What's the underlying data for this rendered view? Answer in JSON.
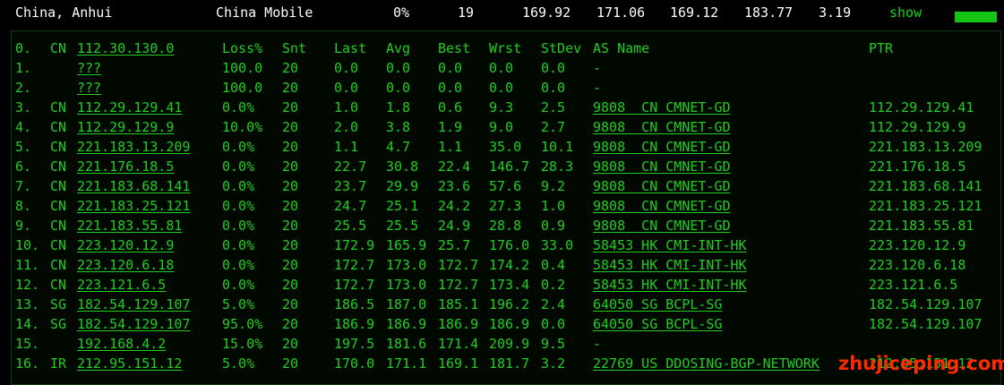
{
  "summary": {
    "location": "China, Anhui",
    "isp": "China Mobile",
    "loss": "0%",
    "sent": "19",
    "last": "169.92",
    "avg": "171.06",
    "best": "169.12",
    "worst": "183.77",
    "stdev": "3.19",
    "show_label": "show"
  },
  "headers": {
    "loss": "Loss%",
    "snt": "Snt",
    "last": "Last",
    "avg": "Avg",
    "best": "Best",
    "wrst": "Wrst",
    "stdev": "StDev",
    "asname": "AS Name",
    "ptr": "PTR"
  },
  "hops": [
    {
      "n": "0.",
      "cc": "CN",
      "ip": "112.30.130.0",
      "loss": "",
      "snt": "",
      "last": "",
      "avg": "",
      "best": "",
      "wrst": "",
      "stdev": "",
      "as": "",
      "ptr": ""
    },
    {
      "n": "1.",
      "cc": "",
      "ip": "???",
      "loss": "100.0",
      "snt": "20",
      "last": "0.0",
      "avg": "0.0",
      "best": "0.0",
      "wrst": "0.0",
      "stdev": "0.0",
      "as": "-",
      "ptr": ""
    },
    {
      "n": "2.",
      "cc": "",
      "ip": "???",
      "loss": "100.0",
      "snt": "20",
      "last": "0.0",
      "avg": "0.0",
      "best": "0.0",
      "wrst": "0.0",
      "stdev": "0.0",
      "as": "-",
      "ptr": ""
    },
    {
      "n": "3.",
      "cc": "CN",
      "ip": "112.29.129.41",
      "loss": "0.0%",
      "snt": "20",
      "last": "1.0",
      "avg": "1.8",
      "best": "0.6",
      "wrst": "9.3",
      "stdev": "2.5",
      "as": "9808  CN CMNET-GD",
      "ptr": "112.29.129.41"
    },
    {
      "n": "4.",
      "cc": "CN",
      "ip": "112.29.129.9",
      "loss": "10.0%",
      "snt": "20",
      "last": "2.0",
      "avg": "3.8",
      "best": "1.9",
      "wrst": "9.0",
      "stdev": "2.7",
      "as": "9808  CN CMNET-GD",
      "ptr": "112.29.129.9"
    },
    {
      "n": "5.",
      "cc": "CN",
      "ip": "221.183.13.209",
      "loss": "0.0%",
      "snt": "20",
      "last": "1.1",
      "avg": "4.7",
      "best": "1.1",
      "wrst": "35.0",
      "stdev": "10.1",
      "as": "9808  CN CMNET-GD",
      "ptr": "221.183.13.209"
    },
    {
      "n": "6.",
      "cc": "CN",
      "ip": "221.176.18.5",
      "loss": "0.0%",
      "snt": "20",
      "last": "22.7",
      "avg": "30.8",
      "best": "22.4",
      "wrst": "146.7",
      "stdev": "28.3",
      "as": "9808  CN CMNET-GD",
      "ptr": "221.176.18.5"
    },
    {
      "n": "7.",
      "cc": "CN",
      "ip": "221.183.68.141",
      "loss": "0.0%",
      "snt": "20",
      "last": "23.7",
      "avg": "29.9",
      "best": "23.6",
      "wrst": "57.6",
      "stdev": "9.2",
      "as": "9808  CN CMNET-GD",
      "ptr": "221.183.68.141"
    },
    {
      "n": "8.",
      "cc": "CN",
      "ip": "221.183.25.121",
      "loss": "0.0%",
      "snt": "20",
      "last": "24.7",
      "avg": "25.1",
      "best": "24.2",
      "wrst": "27.3",
      "stdev": "1.0",
      "as": "9808  CN CMNET-GD",
      "ptr": "221.183.25.121"
    },
    {
      "n": "9.",
      "cc": "CN",
      "ip": "221.183.55.81",
      "loss": "0.0%",
      "snt": "20",
      "last": "25.5",
      "avg": "25.5",
      "best": "24.9",
      "wrst": "28.8",
      "stdev": "0.9",
      "as": "9808  CN CMNET-GD",
      "ptr": "221.183.55.81"
    },
    {
      "n": "10.",
      "cc": "CN",
      "ip": "223.120.12.9",
      "loss": "0.0%",
      "snt": "20",
      "last": "172.9",
      "avg": "165.9",
      "best": "25.7",
      "wrst": "176.0",
      "stdev": "33.0",
      "as": "58453 HK CMI-INT-HK",
      "ptr": "223.120.12.9"
    },
    {
      "n": "11.",
      "cc": "CN",
      "ip": "223.120.6.18",
      "loss": "0.0%",
      "snt": "20",
      "last": "172.7",
      "avg": "173.0",
      "best": "172.7",
      "wrst": "174.2",
      "stdev": "0.4",
      "as": "58453 HK CMI-INT-HK",
      "ptr": "223.120.6.18"
    },
    {
      "n": "12.",
      "cc": "CN",
      "ip": "223.121.6.5",
      "loss": "0.0%",
      "snt": "20",
      "last": "172.7",
      "avg": "173.0",
      "best": "172.7",
      "wrst": "173.4",
      "stdev": "0.2",
      "as": "58453 HK CMI-INT-HK",
      "ptr": "223.121.6.5"
    },
    {
      "n": "13.",
      "cc": "SG",
      "ip": "182.54.129.107",
      "loss": "5.0%",
      "snt": "20",
      "last": "186.5",
      "avg": "187.0",
      "best": "185.1",
      "wrst": "196.2",
      "stdev": "2.4",
      "as": "64050 SG BCPL-SG",
      "ptr": "182.54.129.107"
    },
    {
      "n": "14.",
      "cc": "SG",
      "ip": "182.54.129.107",
      "loss": "95.0%",
      "snt": "20",
      "last": "186.9",
      "avg": "186.9",
      "best": "186.9",
      "wrst": "186.9",
      "stdev": "0.0",
      "as": "64050 SG BCPL-SG",
      "ptr": "182.54.129.107"
    },
    {
      "n": "15.",
      "cc": "",
      "ip": "192.168.4.2",
      "loss": "15.0%",
      "snt": "20",
      "last": "197.5",
      "avg": "181.6",
      "best": "171.4",
      "wrst": "209.9",
      "stdev": "9.5",
      "as": "-",
      "ptr": ""
    },
    {
      "n": "16.",
      "cc": "IR",
      "ip": "212.95.151.12",
      "loss": "5.0%",
      "snt": "20",
      "last": "170.0",
      "avg": "171.1",
      "best": "169.1",
      "wrst": "181.7",
      "stdev": "3.2",
      "as": "22769 US DDOSING-BGP-NETWORK",
      "ptr": "212.95.151.12"
    }
  ],
  "watermark": "zhujiceping.com",
  "colors": {
    "text": "#22cc22",
    "header_text": "#ffffff",
    "watermark": "#ff2a00",
    "background": "#000000"
  }
}
